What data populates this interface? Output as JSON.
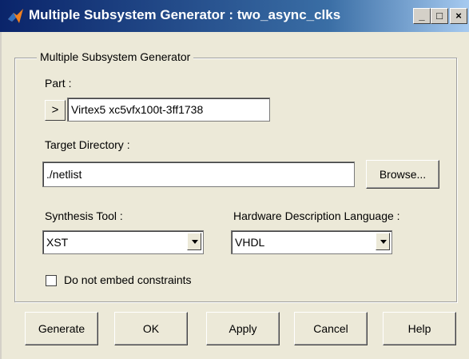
{
  "window": {
    "title": "Multiple Subsystem Generator : two_async_clks",
    "minimize_label": "_",
    "maximize_label": "□",
    "close_label": "×"
  },
  "group": {
    "legend": "Multiple Subsystem Generator"
  },
  "part": {
    "label": "Part :",
    "picker_label": ">",
    "value": "Virtex5  xc5vfx100t-3ff1738"
  },
  "target_directory": {
    "label": "Target Directory :",
    "value": "./netlist",
    "browse_label": "Browse..."
  },
  "synthesis_tool": {
    "label": "Synthesis Tool :",
    "selected": "XST"
  },
  "hdl": {
    "label": "Hardware Description Language :",
    "selected": "VHDL"
  },
  "constraints": {
    "label": "Do not embed constraints",
    "checked": false
  },
  "buttons": {
    "generate": "Generate",
    "ok": "OK",
    "apply": "Apply",
    "cancel": "Cancel",
    "help": "Help"
  }
}
